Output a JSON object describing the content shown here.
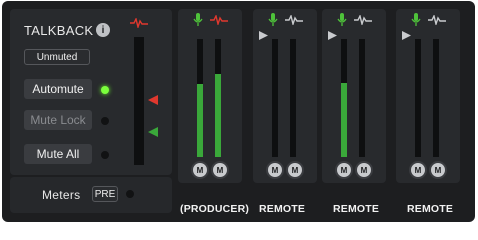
{
  "talkback": {
    "title": "TALKBACK",
    "info_icon": "info-icon",
    "status": "Unmuted",
    "buttons": [
      {
        "label": "Automute",
        "led": "on"
      },
      {
        "label": "Mute Lock",
        "led": "off",
        "disabled": true
      },
      {
        "label": "Mute All",
        "led": "off"
      }
    ],
    "meters_label": "Meters",
    "meters_mode": "PRE",
    "signal_icon": "waveform-red-icon",
    "markers": [
      "red-arrow-marker",
      "green-arrow-marker"
    ]
  },
  "channels": [
    {
      "name": "(PRODUCER)",
      "mic_icon": "mic-green-icon",
      "wave_icon": "waveform-red-icon",
      "has_marker": false,
      "levels": [
        0.62,
        0.7
      ],
      "buttons": [
        "M",
        "M"
      ]
    },
    {
      "name": "REMOTE",
      "mic_icon": "mic-green-icon",
      "wave_icon": "waveform-white-icon",
      "has_marker": true,
      "levels": [
        0.0,
        0.0
      ],
      "buttons": [
        "M",
        "M"
      ]
    },
    {
      "name": "REMOTE",
      "mic_icon": "mic-green-icon",
      "wave_icon": "waveform-white-icon",
      "has_marker": true,
      "levels": [
        0.63,
        0.0
      ],
      "buttons": [
        "M",
        "M"
      ]
    },
    {
      "name": "REMOTE",
      "mic_icon": "mic-green-icon",
      "wave_icon": "waveform-white-icon",
      "has_marker": true,
      "levels": [
        0.0,
        0.0
      ],
      "buttons": [
        "M",
        "M"
      ]
    }
  ],
  "colors": {
    "accent_green": "#3aa83a",
    "led_green": "#7bff3c",
    "signal_red": "#e0382e",
    "background": "#1d1e20"
  }
}
